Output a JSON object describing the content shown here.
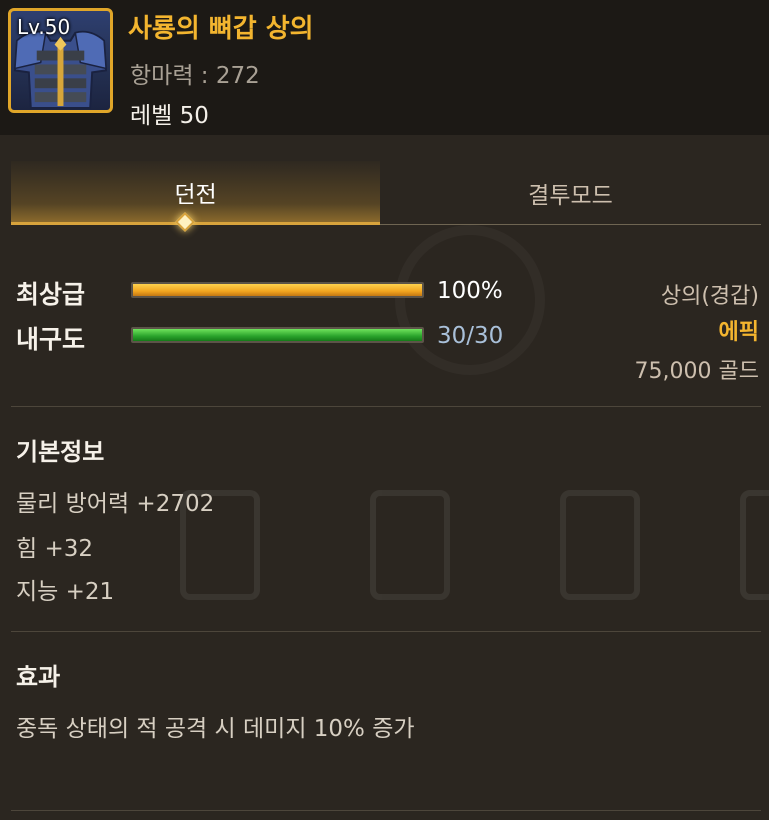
{
  "item": {
    "level_badge": "Lv.50",
    "name": "사룡의 뼈갑 상의",
    "magic_resistance": "항마력 : 272",
    "level_text": "레벨 50",
    "icon": "armor-chestplate-icon"
  },
  "tabs": [
    {
      "label": "던전",
      "active": true
    },
    {
      "label": "결투모드",
      "active": false
    }
  ],
  "stats": {
    "quality": {
      "label": "최상급",
      "value_text": "100%",
      "fraction": 1.0
    },
    "durability": {
      "label": "내구도",
      "value_text": "30/30",
      "fraction": 1.0
    }
  },
  "info": {
    "type": "상의(경갑)",
    "grade": "에픽",
    "price": "75,000 골드"
  },
  "basic_info": {
    "title": "기본정보",
    "lines": [
      "물리 방어력 +2702",
      "힘 +32",
      "지능 +21"
    ]
  },
  "effect": {
    "title": "효과",
    "text": "중독 상태의 적 공격 시 데미지 10% 증가"
  },
  "colors": {
    "title_gold": "#f3b52f",
    "grade_epic": "#f3b52f",
    "quality_bar": "#f2a51f",
    "durability_bar": "#2aa32b",
    "durability_text": "#a9c0d9"
  }
}
